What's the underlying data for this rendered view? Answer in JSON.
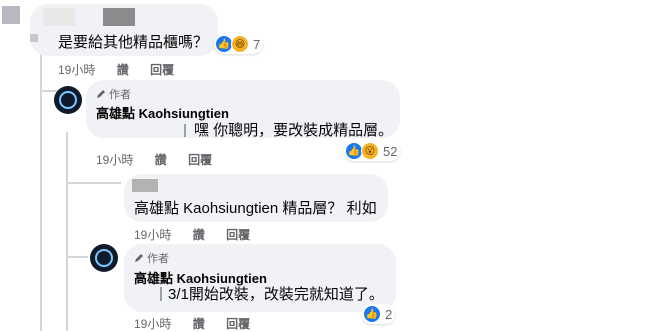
{
  "comments": [
    {
      "text": "是要給其他精品櫃嗎？",
      "reaction_count": "7",
      "time": "19小時",
      "like": "讚",
      "reply": "回覆"
    },
    {
      "author_badge": "作者",
      "author": "高雄點 Kaohsiungtien",
      "text": "嘿 你聰明，要改裝成精品層。",
      "reaction_count": "52",
      "time": "19小時",
      "like": "讚",
      "reply": "回覆"
    },
    {
      "text": "高雄點 Kaohsiungtien 精品層？ 利如",
      "time": "19小時",
      "like": "讚",
      "reply": "回覆"
    },
    {
      "author_badge": "作者",
      "author": "高雄點 Kaohsiungtien",
      "text": "3/1開始改裝，改裝完就知道了。",
      "reaction_count": "2",
      "time": "19小時",
      "like": "讚",
      "reply": "回覆"
    }
  ],
  "icons": {
    "author": "pencil-icon",
    "avatar": "logo-avatar",
    "reaction_like": "like-icon",
    "reaction_haha": "haha-icon",
    "reaction_wow": "wow-icon"
  },
  "colors": {
    "bubble": "#f0f2f5",
    "meta": "#65676b",
    "like": "#1877f2"
  }
}
